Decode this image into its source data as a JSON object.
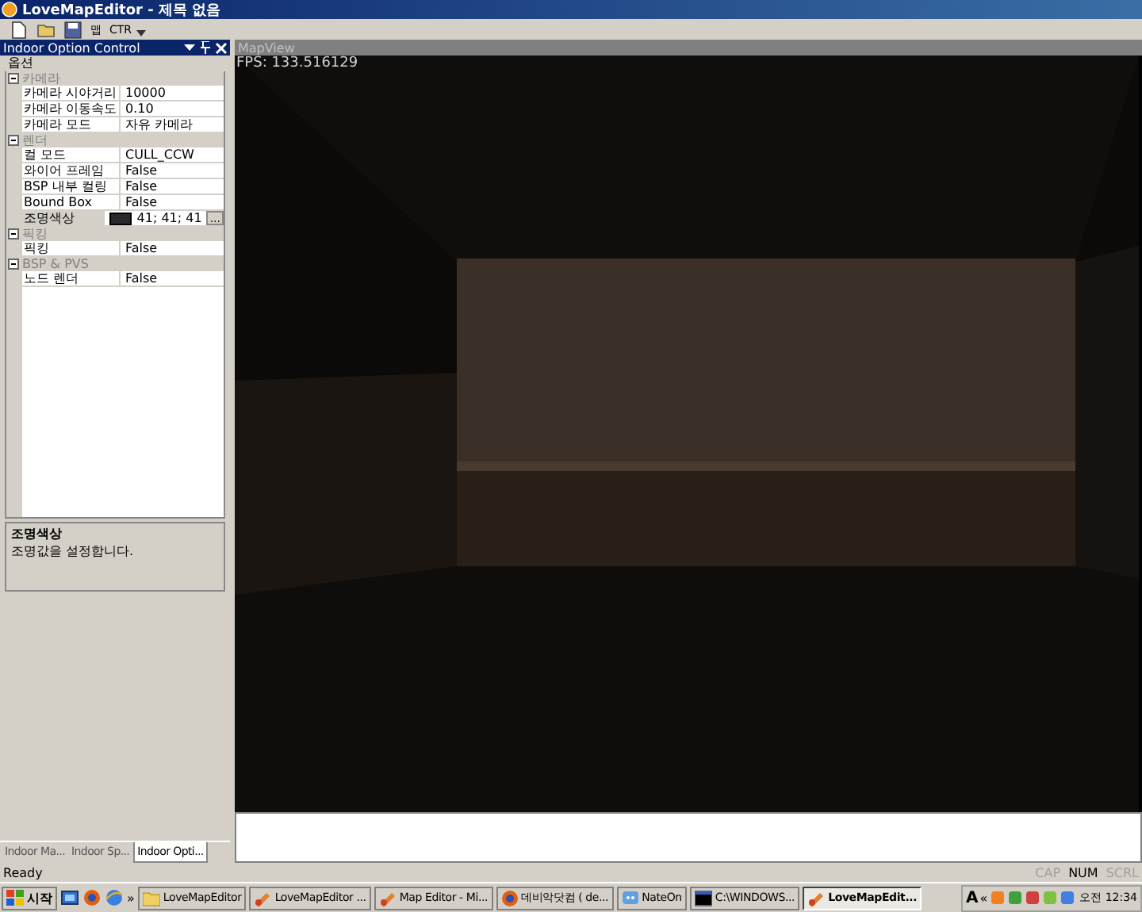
{
  "window": {
    "title": "LoveMapEditor - 제목 없음"
  },
  "toolbar": {
    "buttons": [
      {
        "kind": "new"
      },
      {
        "kind": "open"
      },
      {
        "kind": "save"
      },
      {
        "kind": "text",
        "label": "맵"
      },
      {
        "kind": "text",
        "label": "CTR"
      }
    ]
  },
  "option_panel": {
    "title": "Indoor Option Control",
    "group_label": "옵션",
    "categories": [
      {
        "name": "카메라",
        "expanded": true,
        "rows": [
          {
            "name": "카메라 시야거리",
            "value": "10000",
            "selected": false
          },
          {
            "name": "카메라 이동속도",
            "value": "0.10",
            "selected": false
          },
          {
            "name": "카메라 모드",
            "value": "자유 카메라",
            "selected": false
          }
        ]
      },
      {
        "name": "렌더",
        "expanded": true,
        "rows": [
          {
            "name": "컬 모드",
            "value": "CULL_CCW",
            "selected": false
          },
          {
            "name": "와이어 프레임",
            "value": "False",
            "selected": false
          },
          {
            "name": "BSP 내부 컬링",
            "value": "False",
            "selected": false
          },
          {
            "name": "Bound Box",
            "value": "False",
            "selected": false
          },
          {
            "name": "조명색상",
            "value": "41; 41; 41",
            "color": "#292929",
            "button": "...",
            "selected": true
          }
        ]
      },
      {
        "name": "픽킹",
        "expanded": true,
        "rows": [
          {
            "name": "픽킹",
            "value": "False",
            "selected": false
          }
        ]
      },
      {
        "name": "BSP & PVS",
        "expanded": true,
        "rows": [
          {
            "name": "노드 렌더",
            "value": "False",
            "selected": false
          }
        ]
      }
    ],
    "description": {
      "title": "조명색상",
      "text": "조명값을 설정합니다."
    },
    "tabs": [
      {
        "label": "Indoor Ma...",
        "selected": false
      },
      {
        "label": "Indoor Sp...",
        "selected": false
      },
      {
        "label": "Indoor Opti...",
        "selected": true
      }
    ]
  },
  "map_view": {
    "title": "MapView",
    "fps": "FPS: 133.516129"
  },
  "status_bar": {
    "text": "Ready",
    "indicators": [
      {
        "label": "CAP",
        "on": false
      },
      {
        "label": "NUM",
        "on": true
      },
      {
        "label": "SCRL",
        "on": false
      }
    ]
  },
  "taskbar": {
    "start": "시작",
    "more": "»",
    "buttons": [
      {
        "label": "LoveMapEditor",
        "kind": "folder",
        "selected": false
      },
      {
        "label": "LoveMapEditor ...",
        "kind": "app",
        "selected": false
      },
      {
        "label": "Map Editor - Mi...",
        "kind": "app",
        "selected": false
      },
      {
        "label": "데비악닷컴 ( de...",
        "kind": "browser",
        "selected": false
      },
      {
        "label": "NateOn",
        "kind": "chat",
        "selected": false
      },
      {
        "label": "C:\\WINDOWS...",
        "kind": "console",
        "selected": false
      },
      {
        "label": "LoveMapEdit...",
        "kind": "app",
        "selected": true
      }
    ],
    "tray": {
      "ime": "A",
      "expand": "«",
      "clock": "오전 12:34"
    }
  }
}
